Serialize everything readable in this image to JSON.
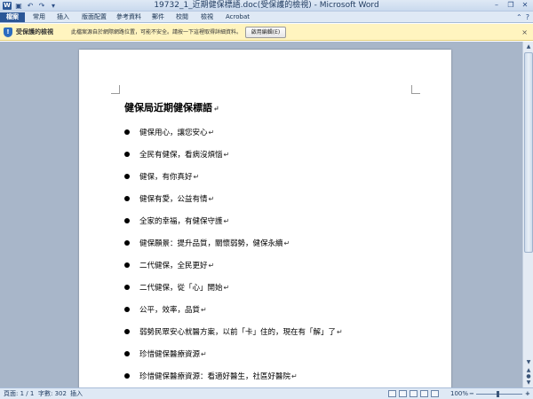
{
  "window": {
    "title": "19732_1_近期健保標語.doc(受保護的檢視) - Microsoft Word",
    "app_icon": "W",
    "qat": [
      "save-icon",
      "undo-icon",
      "redo-icon",
      "customize-icon"
    ],
    "controls": [
      "minimize-icon",
      "restore-icon",
      "close-icon"
    ]
  },
  "ribbon": {
    "tabs": [
      "檔案",
      "常用",
      "插入",
      "版面配置",
      "參考資料",
      "郵件",
      "校閱",
      "檢視",
      "Acrobat"
    ],
    "right_icons": [
      "ribbon-collapse-icon",
      "help-icon"
    ]
  },
  "protected_view": {
    "title": "受保護的檢視",
    "message": "此檔案源自於網際網路位置，可能不安全。請按一下這裡取得詳細資料。",
    "button": "啟用編輯(E)",
    "close": "×"
  },
  "document": {
    "title": "健保局近期健保標語",
    "para_mark": "↵",
    "items": [
      "健保用心，讓您安心",
      "全民有健保，看病沒煩惱",
      "健保，有你真好",
      "健保有愛，公益有情",
      "全家的幸福，有健保守護",
      "健保願景：提升品質，關懷弱勢，健保永續",
      "二代健保，全民更好",
      "二代健保，從「心」開始",
      "公平，效率，品質",
      "弱勢民眾安心就醫方案，以前「卡」住的，現在有「解」了",
      "珍惜健保醫療資源",
      "珍惜健保醫療資源：看適好醫生，社區好醫院"
    ]
  },
  "scrollbar": {
    "up": "▲",
    "down": "▼",
    "prev_page": "▲",
    "browse": "●",
    "next_page": "▼"
  },
  "statusbar": {
    "page": "頁面: 1 / 1",
    "words": "字數: 302",
    "insert": "插入",
    "zoom": "100%",
    "zoom_minus": "−",
    "zoom_plus": "+",
    "zoom_level_percent": 100
  },
  "colors": {
    "file_tab": "#2b5797",
    "message_bar": "#fff4bf",
    "doc_background": "#a8b6c9"
  }
}
